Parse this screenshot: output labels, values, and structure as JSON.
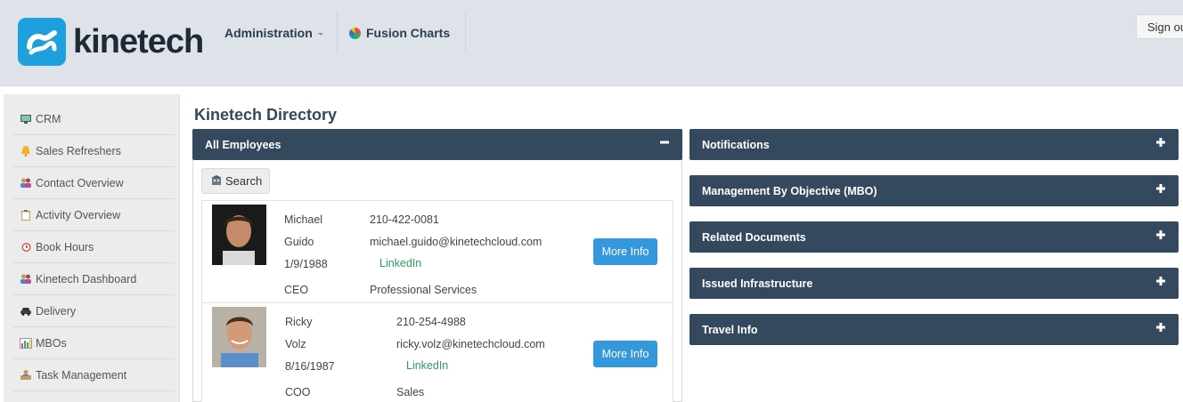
{
  "header": {
    "brand": "kinetech",
    "nav": [
      {
        "label": "Administration"
      },
      {
        "label": "Fusion Charts"
      }
    ],
    "signout_label": "Sign out"
  },
  "sidebar": {
    "items": [
      {
        "label": "CRM",
        "icon": "monitor-icon"
      },
      {
        "label": "Sales Refreshers",
        "icon": "bell-icon"
      },
      {
        "label": "Contact Overview",
        "icon": "people-icon"
      },
      {
        "label": "Activity Overview",
        "icon": "clipboard-icon"
      },
      {
        "label": "Book Hours",
        "icon": "alarm-clock-icon"
      },
      {
        "label": "Kinetech Dashboard",
        "icon": "people-icon"
      },
      {
        "label": "Delivery",
        "icon": "car-icon"
      },
      {
        "label": "MBOs",
        "icon": "bar-chart-icon"
      },
      {
        "label": "Task Management",
        "icon": "person-desk-icon"
      }
    ]
  },
  "main": {
    "title": "Kinetech Directory",
    "employees_panel": {
      "title": "All Employees",
      "search_label": "Search",
      "employees": [
        {
          "first_name": "Michael",
          "last_name": "Guido",
          "birthdate": "1/9/1988",
          "title": "CEO",
          "phone": "210-422-0081",
          "email": "michael.guido@kinetechcloud.com",
          "link": "LinkedIn",
          "department": "Professional Services",
          "more_label": "More Info"
        },
        {
          "first_name": "Ricky",
          "last_name": "Volz",
          "birthdate": "8/16/1987",
          "title": "COO",
          "phone": "210-254-4988",
          "email": "ricky.volz@kinetechcloud.com",
          "link": "LinkedIn",
          "department": "Sales",
          "more_label": "More Info"
        }
      ]
    },
    "side_panels": [
      {
        "title": "Notifications"
      },
      {
        "title": "Management By Objective (MBO)"
      },
      {
        "title": "Related Documents"
      },
      {
        "title": "Issued Infrastructure"
      },
      {
        "title": "Travel Info"
      }
    ]
  },
  "colors": {
    "header_bg": "#dde3e8",
    "panel_head": "#34495e",
    "brand_blue": "#1ea0dc",
    "button_blue": "#3498db",
    "link_green": "#2e9d5f"
  }
}
